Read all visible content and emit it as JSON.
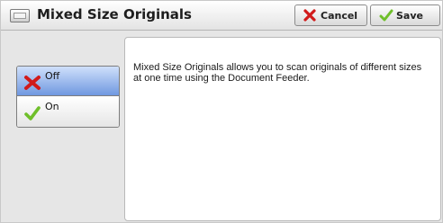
{
  "header": {
    "title": "Mixed Size Originals",
    "icon": "feature-window-icon",
    "cancel_label": "Cancel",
    "save_label": "Save"
  },
  "options": {
    "selected": "Off",
    "items": [
      {
        "label": "Off",
        "icon": "red-x-icon"
      },
      {
        "label": "On",
        "icon": "green-check-icon"
      }
    ]
  },
  "description": {
    "text": "Mixed Size Originals allows you to scan originals of different sizes at one time using the Document Feeder."
  },
  "colors": {
    "selected_option": "#6f98e0",
    "cancel_icon": "#d11a1a",
    "check_icon": "#6fbf2a"
  }
}
